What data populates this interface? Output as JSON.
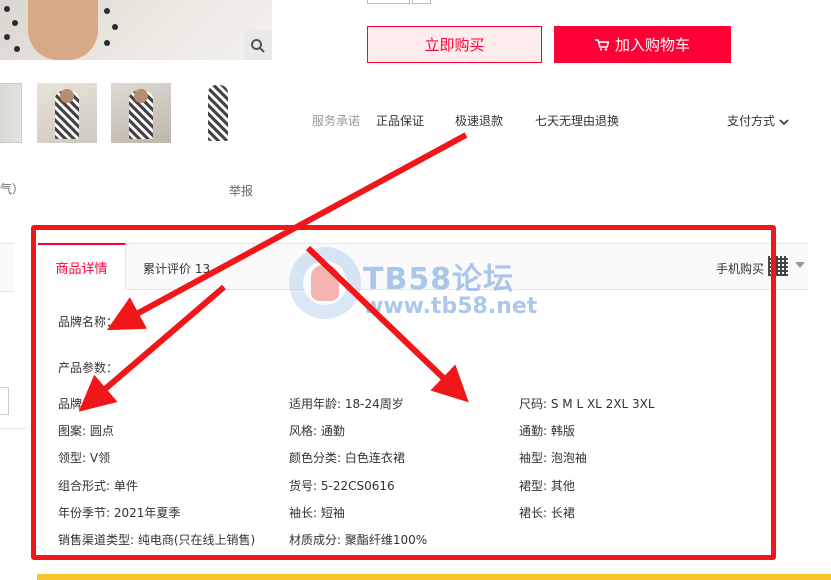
{
  "buttons": {
    "buy_now": "立即购买",
    "add_to_cart": "加入购物车"
  },
  "service": {
    "label": "服务承诺",
    "items": [
      "正品保证",
      "极速退款",
      "七天无理由退换"
    ],
    "payment": "支付方式"
  },
  "misc": {
    "partial_text": "气）",
    "report": "举报"
  },
  "tabs": {
    "details": "商品详情",
    "reviews": "累计评价 13",
    "mobile_buy": "手机购买"
  },
  "brand_label": "品牌名称：",
  "params_label": "产品参数：",
  "params": [
    [
      "品牌:",
      "适用年龄: 18-24周岁",
      "尺码: S M L XL 2XL 3XL"
    ],
    [
      "图案: 圆点",
      "风格: 通勤",
      "通勤: 韩版"
    ],
    [
      "领型: V领",
      "颜色分类: 白色连衣裙",
      "袖型: 泡泡袖"
    ],
    [
      "组合形式: 单件",
      "货号: 5-22CS0616",
      "裙型: 其他"
    ],
    [
      "年份季节: 2021年夏季",
      "袖长: 短袖",
      "裙长: 长裙"
    ],
    [
      "销售渠道类型: 纯电商(只在线上销售)",
      "材质成分: 聚酯纤维100%",
      ""
    ]
  ],
  "watermark": {
    "title": "TB58论坛",
    "url": "www.tb58.net"
  },
  "colors": {
    "accent": "#ff0036",
    "frame": "#f0161a",
    "arrow": "#f0161a",
    "strip": "#f7c62f"
  },
  "icons": {
    "zoom": "search-icon",
    "cart": "cart-icon",
    "dropdown": "chevron-down-icon",
    "qr": "qr-code-icon"
  }
}
